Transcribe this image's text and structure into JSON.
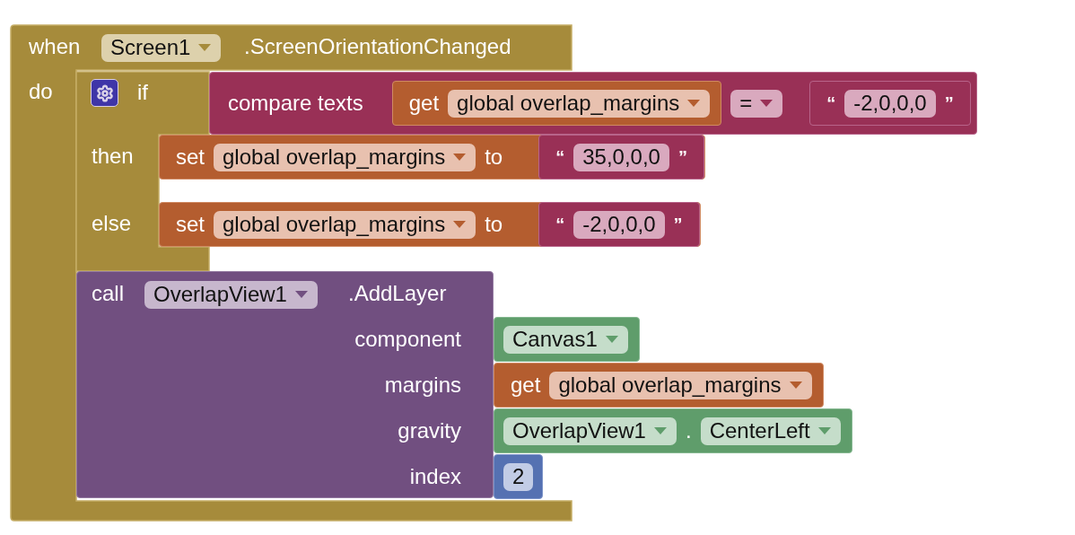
{
  "event": {
    "keyword": "when",
    "component": "Screen1",
    "event": ".ScreenOrientationChanged",
    "do_label": "do",
    "if_block": {
      "if_label": "if",
      "then_label": "then",
      "else_label": "else",
      "condition": {
        "label": "compare texts",
        "left": {
          "keyword": "get",
          "variable": "global overlap_margins"
        },
        "operator": "=",
        "right": {
          "open_quote": "“",
          "text": "-2,0,0,0",
          "close_quote": "”"
        }
      },
      "branches": [
        {
          "keyword": "set",
          "variable": "global overlap_margins",
          "to": "to",
          "value": {
            "open_quote": "“",
            "text": "35,0,0,0",
            "close_quote": "”"
          }
        },
        {
          "keyword": "set",
          "variable": "global overlap_margins",
          "to": "to",
          "value": {
            "open_quote": "“",
            "text": "-2,0,0,0",
            "close_quote": "”"
          }
        }
      ]
    },
    "call": {
      "keyword": "call",
      "component": "OverlapView1",
      "method": ".AddLayer",
      "args": [
        {
          "label": "component",
          "kind": "component",
          "value": "Canvas1"
        },
        {
          "label": "margins",
          "kind": "get",
          "keyword": "get",
          "variable": "global overlap_margins"
        },
        {
          "label": "gravity",
          "kind": "property",
          "component": "OverlapView1",
          "separator": ".",
          "value": "CenterLeft"
        },
        {
          "label": "index",
          "kind": "number",
          "value": "2"
        }
      ]
    }
  }
}
